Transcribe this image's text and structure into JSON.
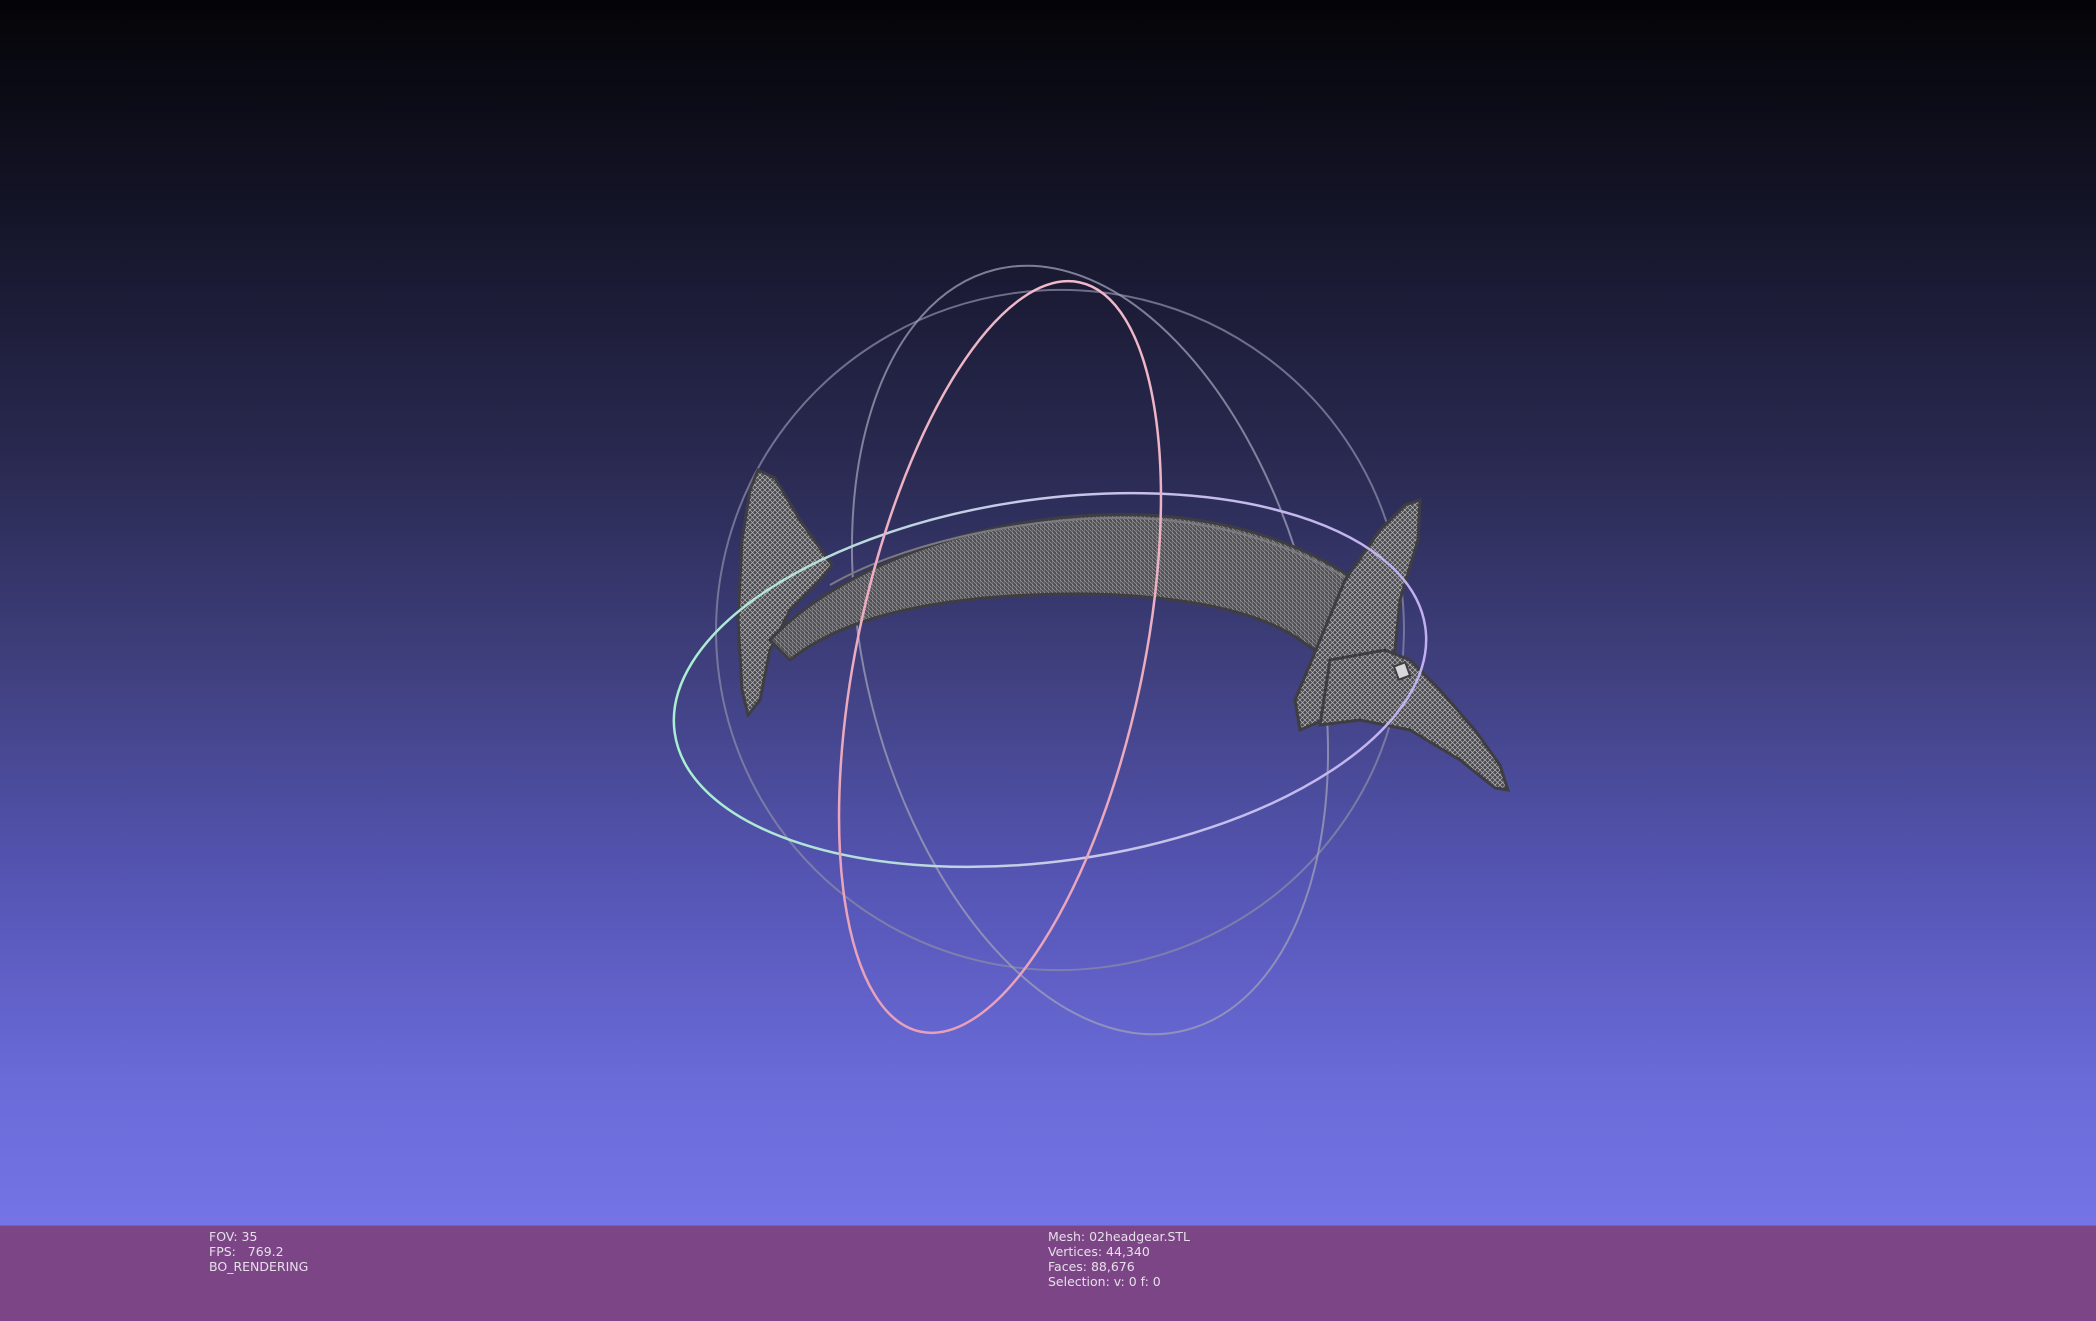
{
  "viewer": {
    "background_top": "#040407",
    "background_bottom": "#7474e6",
    "info_bar_color": "#7c4686",
    "mesh_color": "#5a5a5e",
    "trackball": {
      "horizontal_ring_colors": [
        "#9cf0c8",
        "#b8a8f0"
      ],
      "vertical_ring_color": "#f0a8c0",
      "side_ring_color": "#b0b0c8"
    }
  },
  "info": {
    "fov": "FOV: 35",
    "fps": "FPS:   769.2",
    "render_mode": "BO_RENDERING",
    "mesh": "Mesh: 02headgear.STL",
    "vertices": "Vertices: 44,340",
    "faces": "Faces: 88,676",
    "selection": "Selection: v: 0 f: 0"
  }
}
